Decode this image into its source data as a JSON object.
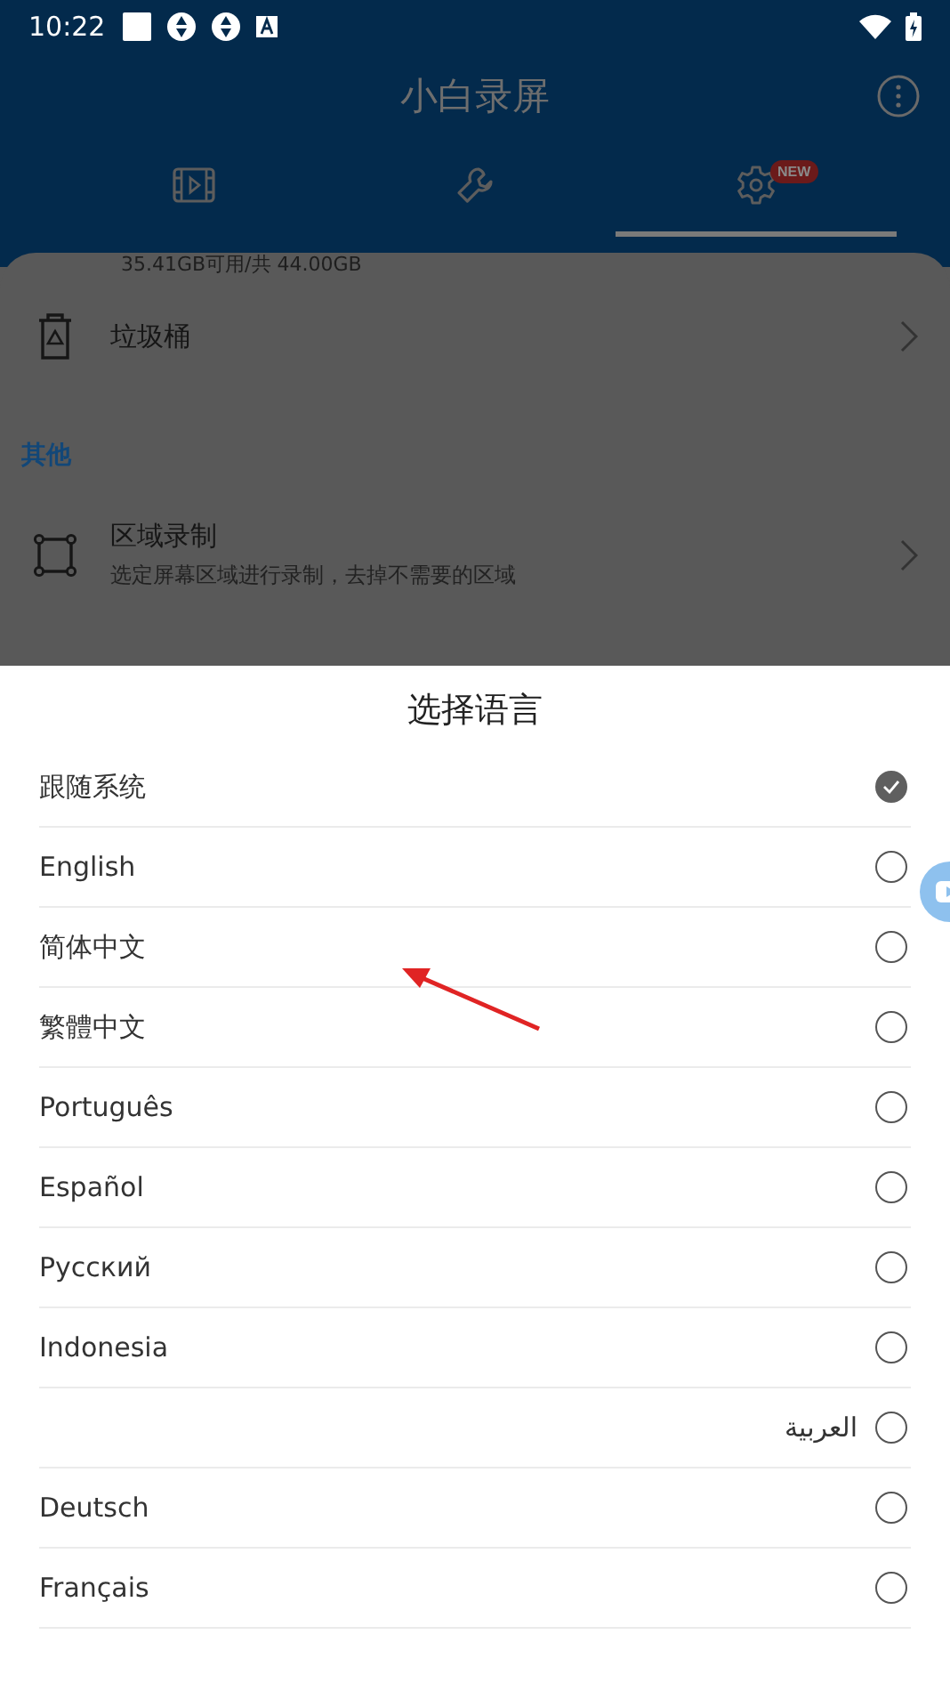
{
  "status_bar": {
    "time": "10:22"
  },
  "app_bar": {
    "title": "小白录屏"
  },
  "tabs": [
    {
      "selected": false
    },
    {
      "selected": false
    },
    {
      "selected": true,
      "badge": "NEW"
    }
  ],
  "storage_text": "35.41GB可用/共 44.00GB",
  "settings": [
    {
      "kind": "row",
      "title": "垃圾桶"
    },
    {
      "kind": "section",
      "title": "其他"
    },
    {
      "kind": "row",
      "title": "区域录制",
      "subtitle": "选定屏幕区域进行录制，去掉不需要的区域"
    }
  ],
  "dialog": {
    "title": "选择语言",
    "options": [
      {
        "label": "跟随系统",
        "selected": true
      },
      {
        "label": "English",
        "selected": false
      },
      {
        "label": "简体中文",
        "selected": false
      },
      {
        "label": "繁體中文",
        "selected": false
      },
      {
        "label": "Português",
        "selected": false
      },
      {
        "label": "Español",
        "selected": false
      },
      {
        "label": "Русский",
        "selected": false
      },
      {
        "label": "Indonesia",
        "selected": false
      },
      {
        "label": "العربية",
        "selected": false
      },
      {
        "label": "Deutsch",
        "selected": false
      },
      {
        "label": "Français",
        "selected": false
      }
    ]
  }
}
